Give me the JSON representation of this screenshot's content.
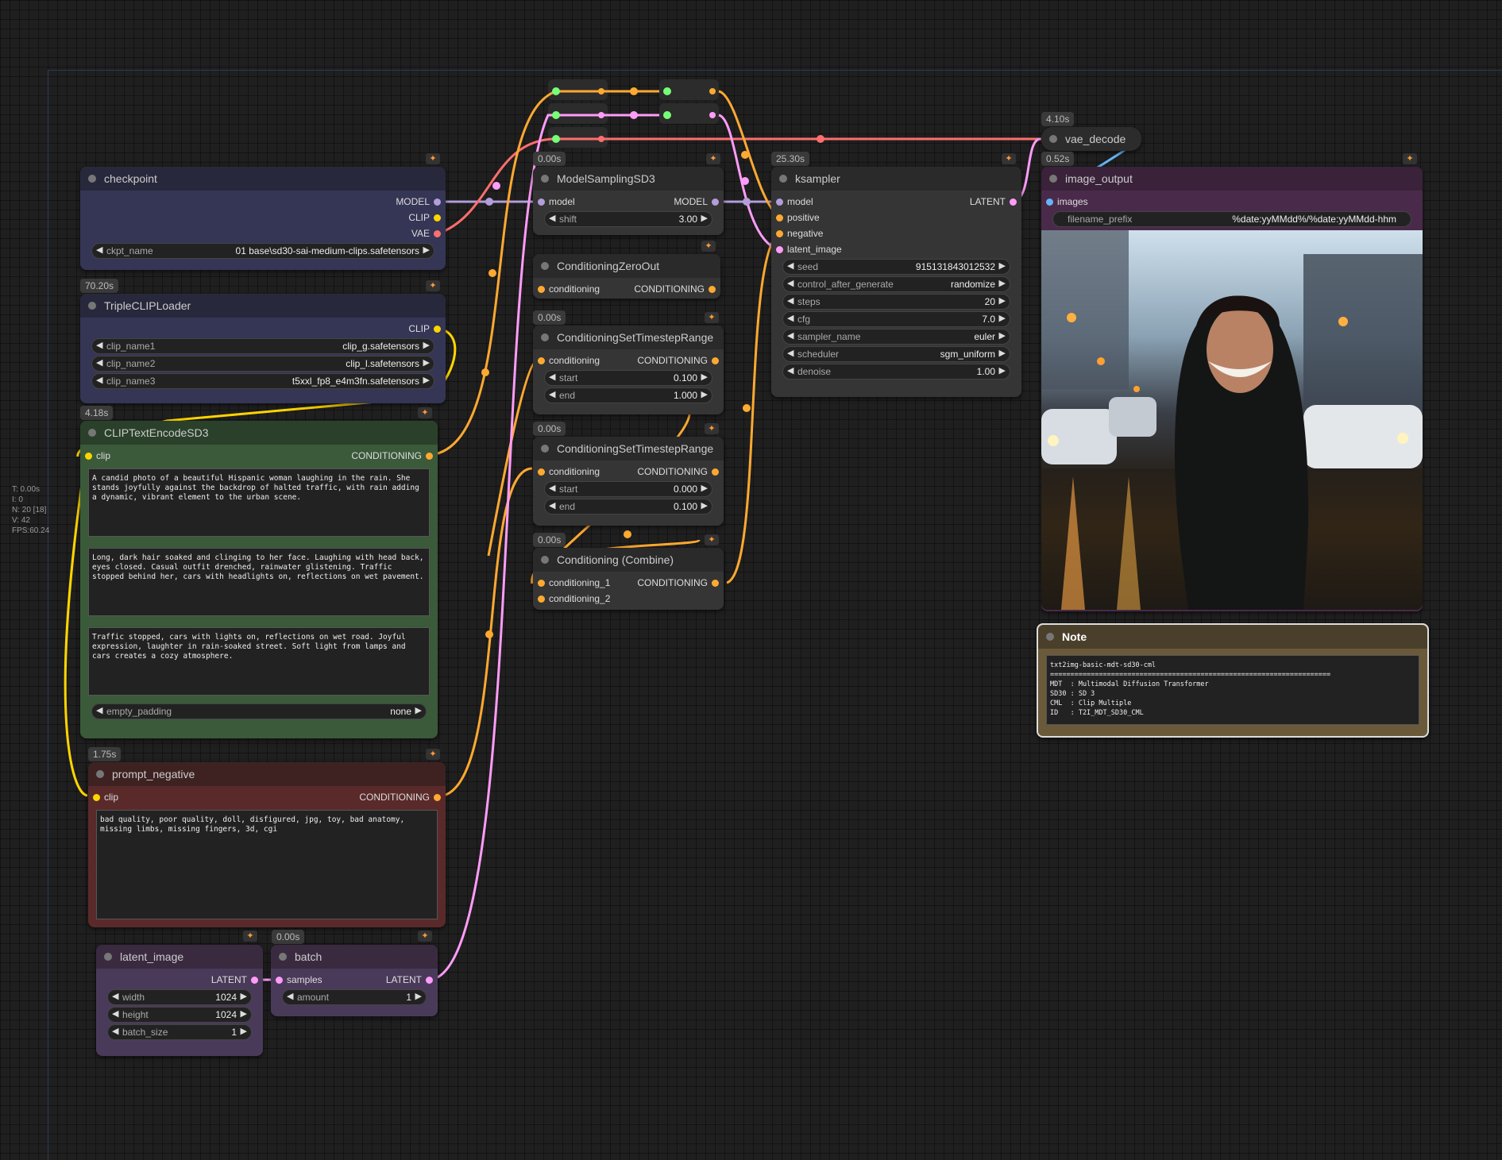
{
  "stats": {
    "t": "T: 0.00s",
    "i": "I: 0",
    "n": "N: 20 [18]",
    "v": "V: 42",
    "fps": "FPS:60.24"
  },
  "checkpoint": {
    "title": "checkpoint",
    "out_model": "MODEL",
    "out_clip": "CLIP",
    "out_vae": "VAE",
    "w_name": "ckpt_name",
    "w_value": "01 base\\sd30-sai-medium-clips.safetensors"
  },
  "triple": {
    "time": "70.20s",
    "title": "TripleCLIPLoader",
    "out_clip": "CLIP",
    "widgets": [
      {
        "name": "clip_name1",
        "value": "clip_g.safetensors"
      },
      {
        "name": "clip_name2",
        "value": "clip_l.safetensors"
      },
      {
        "name": "clip_name3",
        "value": "t5xxl_fp8_e4m3fn.safetensors"
      }
    ]
  },
  "encode": {
    "time": "4.18s",
    "title": "CLIPTextEncodeSD3",
    "in_clip": "clip",
    "out": "CONDITIONING",
    "text1": "A candid photo of a beautiful Hispanic woman laughing in the rain. She stands joyfully against the backdrop of halted traffic, with rain adding a dynamic, vibrant element to the urban scene.",
    "text2": "Long, dark hair soaked and clinging to her face. Laughing with head back, eyes closed. Casual outfit drenched, rainwater glistening. Traffic stopped behind her, cars with headlights on, reflections on wet pavement.",
    "text3": "Traffic stopped, cars with lights on, reflections on wet road. Joyful expression, laughter in rain-soaked street. Soft light from lamps and cars creates a cozy atmosphere.",
    "w_name": "empty_padding",
    "w_value": "none"
  },
  "negative": {
    "time": "1.75s",
    "title": "prompt_negative",
    "in_clip": "clip",
    "out": "CONDITIONING",
    "text": "bad quality, poor quality, doll, disfigured, jpg, toy, bad anatomy, missing limbs, missing fingers, 3d, cgi"
  },
  "latent": {
    "title": "latent_image",
    "out": "LATENT",
    "widgets": [
      {
        "name": "width",
        "value": "1024"
      },
      {
        "name": "height",
        "value": "1024"
      },
      {
        "name": "batch_size",
        "value": "1"
      }
    ]
  },
  "batch": {
    "time": "0.00s",
    "title": "batch",
    "in": "samples",
    "out": "LATENT",
    "w_name": "amount",
    "w_value": "1"
  },
  "msd3": {
    "time": "0.00s",
    "title": "ModelSamplingSD3",
    "in": "model",
    "out": "MODEL",
    "w_name": "shift",
    "w_value": "3.00"
  },
  "czero": {
    "title": "ConditioningZeroOut",
    "in": "conditioning",
    "out": "CONDITIONING"
  },
  "cstr1": {
    "time": "0.00s",
    "title": "ConditioningSetTimestepRange",
    "in": "conditioning",
    "out": "CONDITIONING",
    "widgets": [
      {
        "name": "start",
        "value": "0.100"
      },
      {
        "name": "end",
        "value": "1.000"
      }
    ]
  },
  "cstr2": {
    "time": "0.00s",
    "title": "ConditioningSetTimestepRange",
    "in": "conditioning",
    "out": "CONDITIONING",
    "widgets": [
      {
        "name": "start",
        "value": "0.000"
      },
      {
        "name": "end",
        "value": "0.100"
      }
    ]
  },
  "ccomb": {
    "time": "0.00s",
    "title": "Conditioning (Combine)",
    "in1": "conditioning_1",
    "in2": "conditioning_2",
    "out": "CONDITIONING"
  },
  "ksampler": {
    "time": "25.30s",
    "title": "ksampler",
    "in_model": "model",
    "in_pos": "positive",
    "in_neg": "negative",
    "in_latent": "latent_image",
    "out": "LATENT",
    "widgets": [
      {
        "name": "seed",
        "value": "915131843012532"
      },
      {
        "name": "control_after_generate",
        "value": "randomize"
      },
      {
        "name": "steps",
        "value": "20"
      },
      {
        "name": "cfg",
        "value": "7.0"
      },
      {
        "name": "sampler_name",
        "value": "euler"
      },
      {
        "name": "scheduler",
        "value": "sgm_uniform"
      },
      {
        "name": "denoise",
        "value": "1.00"
      }
    ]
  },
  "vae": {
    "time": "4.10s",
    "title": "vae_decode"
  },
  "output": {
    "time": "0.52s",
    "title": "image_output",
    "in": "images",
    "w_name": "filename_prefix",
    "w_value": "%date:yyMMdd%/%date:yyMMdd-hhm"
  },
  "note": {
    "title": "Note",
    "text": "txt2img-basic-mdt-sd30-cml\n=====================================================================\nMDT  : Multimodal Diffusion Transformer\nSD30 : SD 3\nCML  : Clip Multiple\nID   : T2I_MDT_SD30_CML"
  },
  "colors": {
    "model": "#b39ddb",
    "clip": "#ffd500",
    "vae": "#ff6e6e",
    "conditioning": "#ffa931",
    "latent": "#ff9cf9",
    "image": "#64b5f6"
  }
}
